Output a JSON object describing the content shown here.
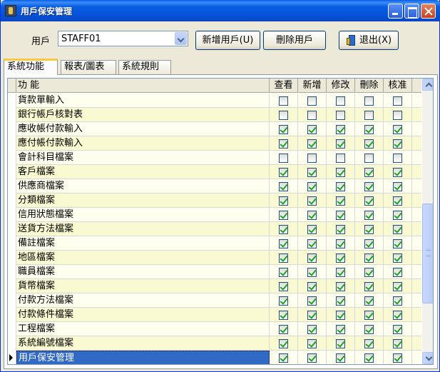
{
  "window": {
    "title": "用戶保安管理"
  },
  "toolbar": {
    "user_label": "用戶",
    "user_value": "STAFF01",
    "add_user_label": "新增用戶(U)",
    "delete_user_label": "刪除用戶",
    "exit_label": "退出(X)"
  },
  "tabs": [
    {
      "label": "系統功能",
      "active": true
    },
    {
      "label": "報表/圖表",
      "active": false
    },
    {
      "label": "系統規則",
      "active": false
    }
  ],
  "grid": {
    "columns": [
      "功 能",
      "查看",
      "新增",
      "修改",
      "刪除",
      "核准"
    ],
    "rows": [
      {
        "name": "貨款單輸入",
        "perms": [
          false,
          false,
          false,
          false,
          false
        ]
      },
      {
        "name": "銀行帳戶核對表",
        "perms": [
          false,
          false,
          false,
          false,
          false
        ]
      },
      {
        "name": "應收帳付款輸入",
        "perms": [
          true,
          true,
          true,
          true,
          true
        ]
      },
      {
        "name": "應付帳付款輸入",
        "perms": [
          true,
          true,
          true,
          true,
          true
        ]
      },
      {
        "name": "會計科目檔案",
        "perms": [
          false,
          false,
          false,
          false,
          false
        ]
      },
      {
        "name": "客戶檔案",
        "perms": [
          true,
          true,
          true,
          true,
          true
        ]
      },
      {
        "name": "供應商檔案",
        "perms": [
          true,
          true,
          true,
          true,
          true
        ]
      },
      {
        "name": "分類檔案",
        "perms": [
          true,
          true,
          true,
          true,
          true
        ]
      },
      {
        "name": "信用狀態檔案",
        "perms": [
          true,
          true,
          true,
          true,
          true
        ]
      },
      {
        "name": "送貨方法檔案",
        "perms": [
          true,
          true,
          true,
          true,
          true
        ]
      },
      {
        "name": "備註檔案",
        "perms": [
          true,
          true,
          true,
          true,
          true
        ]
      },
      {
        "name": "地區檔案",
        "perms": [
          true,
          true,
          true,
          true,
          true
        ]
      },
      {
        "name": "職員檔案",
        "perms": [
          true,
          true,
          true,
          true,
          true
        ]
      },
      {
        "name": "貨幣檔案",
        "perms": [
          true,
          true,
          true,
          true,
          true
        ]
      },
      {
        "name": "付款方法檔案",
        "perms": [
          true,
          true,
          true,
          true,
          true
        ]
      },
      {
        "name": "付款條件檔案",
        "perms": [
          true,
          true,
          true,
          true,
          true
        ]
      },
      {
        "name": "工程檔案",
        "perms": [
          true,
          true,
          true,
          true,
          true
        ]
      },
      {
        "name": "系統編號檔案",
        "perms": [
          true,
          true,
          true,
          true,
          true
        ]
      },
      {
        "name": "用戶保安管理",
        "perms": [
          true,
          true,
          true,
          true,
          true
        ],
        "current": true
      }
    ]
  }
}
